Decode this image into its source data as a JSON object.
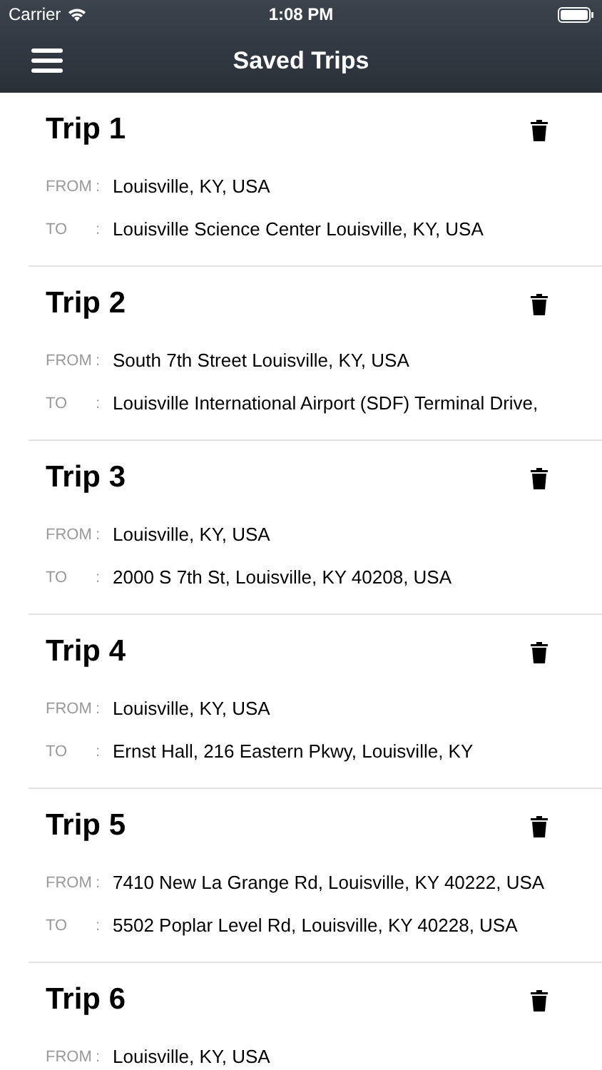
{
  "status_bar": {
    "carrier": "Carrier",
    "time": "1:08 PM"
  },
  "nav": {
    "title": "Saved Trips"
  },
  "trips": [
    {
      "title": "Trip 1",
      "rows": [
        {
          "label": "FROM",
          "colon": ":",
          "value": "Louisville, KY, USA"
        },
        {
          "label": "TO",
          "colon": ":",
          "value": "Louisville Science Center Louisville, KY, USA"
        }
      ]
    },
    {
      "title": "Trip 2",
      "rows": [
        {
          "label": "FROM",
          "colon": ":",
          "value": "South 7th Street Louisville, KY, USA"
        },
        {
          "label": "TO",
          "colon": ":",
          "value": "Louisville International Airport (SDF) Terminal Drive,"
        }
      ]
    },
    {
      "title": "Trip 3",
      "rows": [
        {
          "label": "FROM",
          "colon": ":",
          "value": "Louisville, KY, USA"
        },
        {
          "label": "TO",
          "colon": ":",
          "value": "2000 S 7th St, Louisville, KY 40208, USA"
        }
      ]
    },
    {
      "title": "Trip 4",
      "rows": [
        {
          "label": "FROM",
          "colon": ":",
          "value": "Louisville, KY, USA"
        },
        {
          "label": "TO",
          "colon": ":",
          "value": "Ernst Hall, 216 Eastern Pkwy, Louisville, KY"
        }
      ]
    },
    {
      "title": "Trip 5",
      "rows": [
        {
          "label": "FROM",
          "colon": ":",
          "value": "7410 New La Grange Rd, Louisville, KY 40222, USA"
        },
        {
          "label": "TO",
          "colon": ":",
          "value": "5502 Poplar Level Rd, Louisville, KY 40228, USA"
        }
      ]
    },
    {
      "title": "Trip 6",
      "rows": [
        {
          "label": "FROM",
          "colon": ":",
          "value": "Louisville, KY, USA"
        }
      ]
    }
  ]
}
